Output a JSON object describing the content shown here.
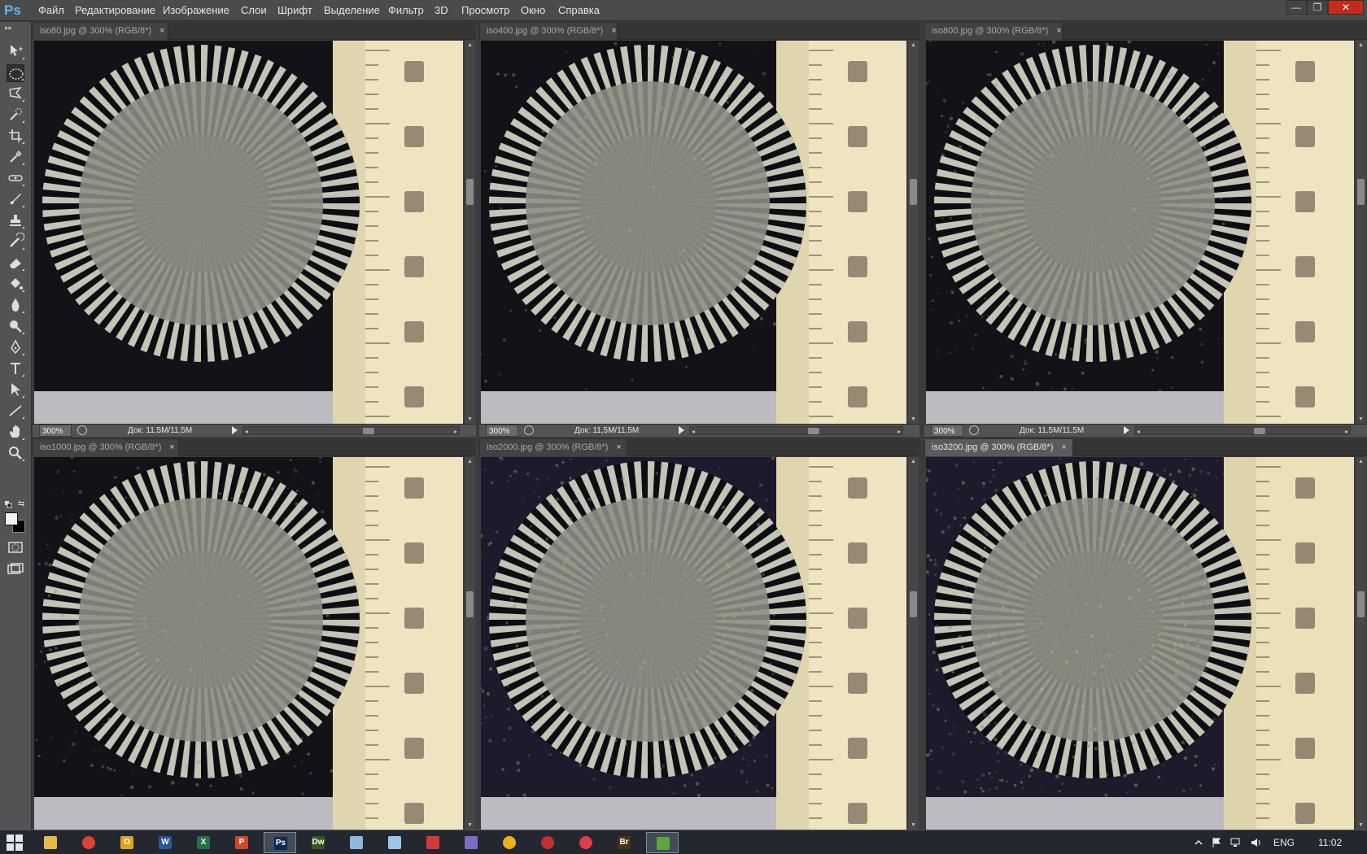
{
  "app": {
    "logo": "Ps",
    "menu": [
      "Файл",
      "Редактирование",
      "Изображение",
      "Слои",
      "Шрифт",
      "Выделение",
      "Фильтр",
      "3D",
      "Просмотр",
      "Окно",
      "Справка"
    ],
    "window_controls": {
      "minimize": "—",
      "restore": "❐",
      "close": "✕"
    }
  },
  "toolbar": {
    "tools": [
      "move-tool",
      "elliptical-marquee-tool",
      "lasso-tool",
      "quick-selection-tool",
      "crop-tool",
      "eyedropper-tool",
      "spot-healing-tool",
      "brush-tool",
      "clone-stamp-tool",
      "history-brush-tool",
      "eraser-tool",
      "paint-bucket-tool",
      "blur-tool",
      "dodge-tool",
      "pen-tool",
      "type-tool",
      "path-selection-tool",
      "line-tool",
      "hand-tool",
      "zoom-tool"
    ],
    "active_tool": "elliptical-marquee-tool",
    "foreground_color": "#f2f2f2",
    "background_color": "#000000"
  },
  "documents": [
    {
      "tab": "iso80.jpg @ 300% (RGB/8*)",
      "close": "×",
      "zoom": "300%",
      "doc_info": "Док: 11,5M/11,5M",
      "active": false,
      "noise": 0
    },
    {
      "tab": "iso400.jpg @ 300% (RGB/8*)",
      "close": "×",
      "zoom": "300%",
      "doc_info": "Док: 11,5M/11,5M",
      "active": false,
      "noise": 1
    },
    {
      "tab": "iso800.jpg @ 300% (RGB/8*)",
      "close": "×",
      "zoom": "300%",
      "doc_info": "Док: 11,5M/11,5M",
      "active": false,
      "noise": 2
    },
    {
      "tab": "iso1000.jpg @ 300% (RGB/8*)",
      "close": "×",
      "zoom": "",
      "doc_info": "",
      "active": false,
      "noise": 2
    },
    {
      "tab": "iso2000.jpg @ 300% (RGB/8*)",
      "close": "×",
      "zoom": "",
      "doc_info": "",
      "active": false,
      "noise": 3
    },
    {
      "tab": "iso3200.jpg @ 300% (RGB/8*)",
      "close": "×",
      "zoom": "",
      "doc_info": "",
      "active": true,
      "noise": 4
    }
  ],
  "taskbar": {
    "apps": [
      {
        "name": "file-explorer-icon",
        "label": "",
        "color": "#e7b84a",
        "active": false
      },
      {
        "name": "chrome-icon",
        "label": "",
        "color": "#d9432f",
        "active": false
      },
      {
        "name": "outlook-icon",
        "label": "O",
        "color": "#e0a31a",
        "active": false
      },
      {
        "name": "word-icon",
        "label": "W",
        "color": "#2b579a",
        "active": false
      },
      {
        "name": "excel-icon",
        "label": "X",
        "color": "#217346",
        "active": false
      },
      {
        "name": "powerpoint-icon",
        "label": "P",
        "color": "#d24726",
        "active": false
      },
      {
        "name": "photoshop-icon",
        "label": "Ps",
        "color": "#0c2b4e",
        "active": true
      },
      {
        "name": "dreamweaver-icon",
        "label": "Dw",
        "color": "#35591c",
        "active": false
      },
      {
        "name": "notepad-icon",
        "label": "",
        "color": "#8fb8e0",
        "active": false
      },
      {
        "name": "document-icon",
        "label": "",
        "color": "#9fc6e8",
        "active": false
      },
      {
        "name": "game-icon",
        "label": "",
        "color": "#d23a3a",
        "active": false
      },
      {
        "name": "archive-icon",
        "label": "",
        "color": "#7a6fc0",
        "active": false
      },
      {
        "name": "warning-app-icon",
        "label": "",
        "color": "#e8b21a",
        "active": false
      },
      {
        "name": "red-ball-icon",
        "label": "",
        "color": "#c0302e",
        "active": false
      },
      {
        "name": "media-player-icon",
        "label": "",
        "color": "#e23b4a",
        "active": false
      },
      {
        "name": "bridge-icon",
        "label": "Br",
        "color": "#4a3510",
        "active": false
      },
      {
        "name": "torrent-icon",
        "label": "",
        "color": "#5aa83b",
        "active": true
      }
    ],
    "language": "ENG",
    "time": "11:02"
  }
}
